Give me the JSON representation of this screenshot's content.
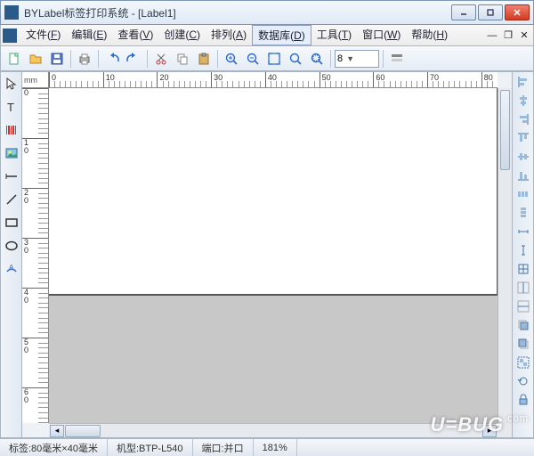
{
  "window": {
    "title": "BYLabel标签打印系统 - [Label1]"
  },
  "menu": {
    "items": [
      {
        "label": "文件",
        "key": "F"
      },
      {
        "label": "编辑",
        "key": "E"
      },
      {
        "label": "查看",
        "key": "V"
      },
      {
        "label": "创建",
        "key": "C"
      },
      {
        "label": "排列",
        "key": "A"
      },
      {
        "label": "数据库",
        "key": "D",
        "selected": true
      },
      {
        "label": "工具",
        "key": "T"
      },
      {
        "label": "窗口",
        "key": "W"
      },
      {
        "label": "帮助",
        "key": "H"
      }
    ]
  },
  "toolbar": {
    "font_size": "8"
  },
  "ruler": {
    "unit": "mm",
    "h_ticks": [
      0,
      10,
      20,
      30,
      40,
      50,
      60,
      70,
      80
    ],
    "v_ticks": [
      0,
      10,
      20,
      30,
      40,
      50,
      60
    ]
  },
  "status": {
    "label_size": "标签:80毫米×40毫米",
    "model": "机型:BTP-L540",
    "port": "端口:并口",
    "zoom": "181%"
  },
  "watermark": "U=BUG"
}
